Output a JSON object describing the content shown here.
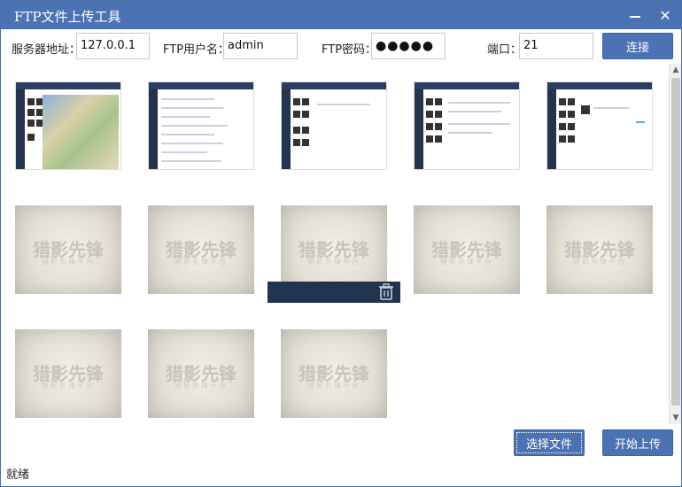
{
  "window": {
    "title": "FTP文件上传工具",
    "minimize_icon": "minimize-icon",
    "close_icon": "close-icon"
  },
  "connection": {
    "server_label": "服务器地址：",
    "server_value": "127.0.0.1",
    "user_label": "FTP用户名：",
    "user_value": "admin",
    "password_label": "FTP密码：",
    "password_value": "●●●●●",
    "port_label": "端口：",
    "port_value": "21",
    "connect_label": "连接"
  },
  "gallery": {
    "screenshot_thumbnails": 5,
    "placeholder_thumbnails": 8,
    "placeholder_text": "猎影先锋",
    "placeholder_subtext": "猎影先锋平台",
    "delete_icon": "trash-icon"
  },
  "actions": {
    "choose_label": "选择文件",
    "upload_label": "开始上传"
  },
  "status": {
    "text": "就绪"
  },
  "colors": {
    "accent": "#4b72b3",
    "overlay": "#203450"
  }
}
